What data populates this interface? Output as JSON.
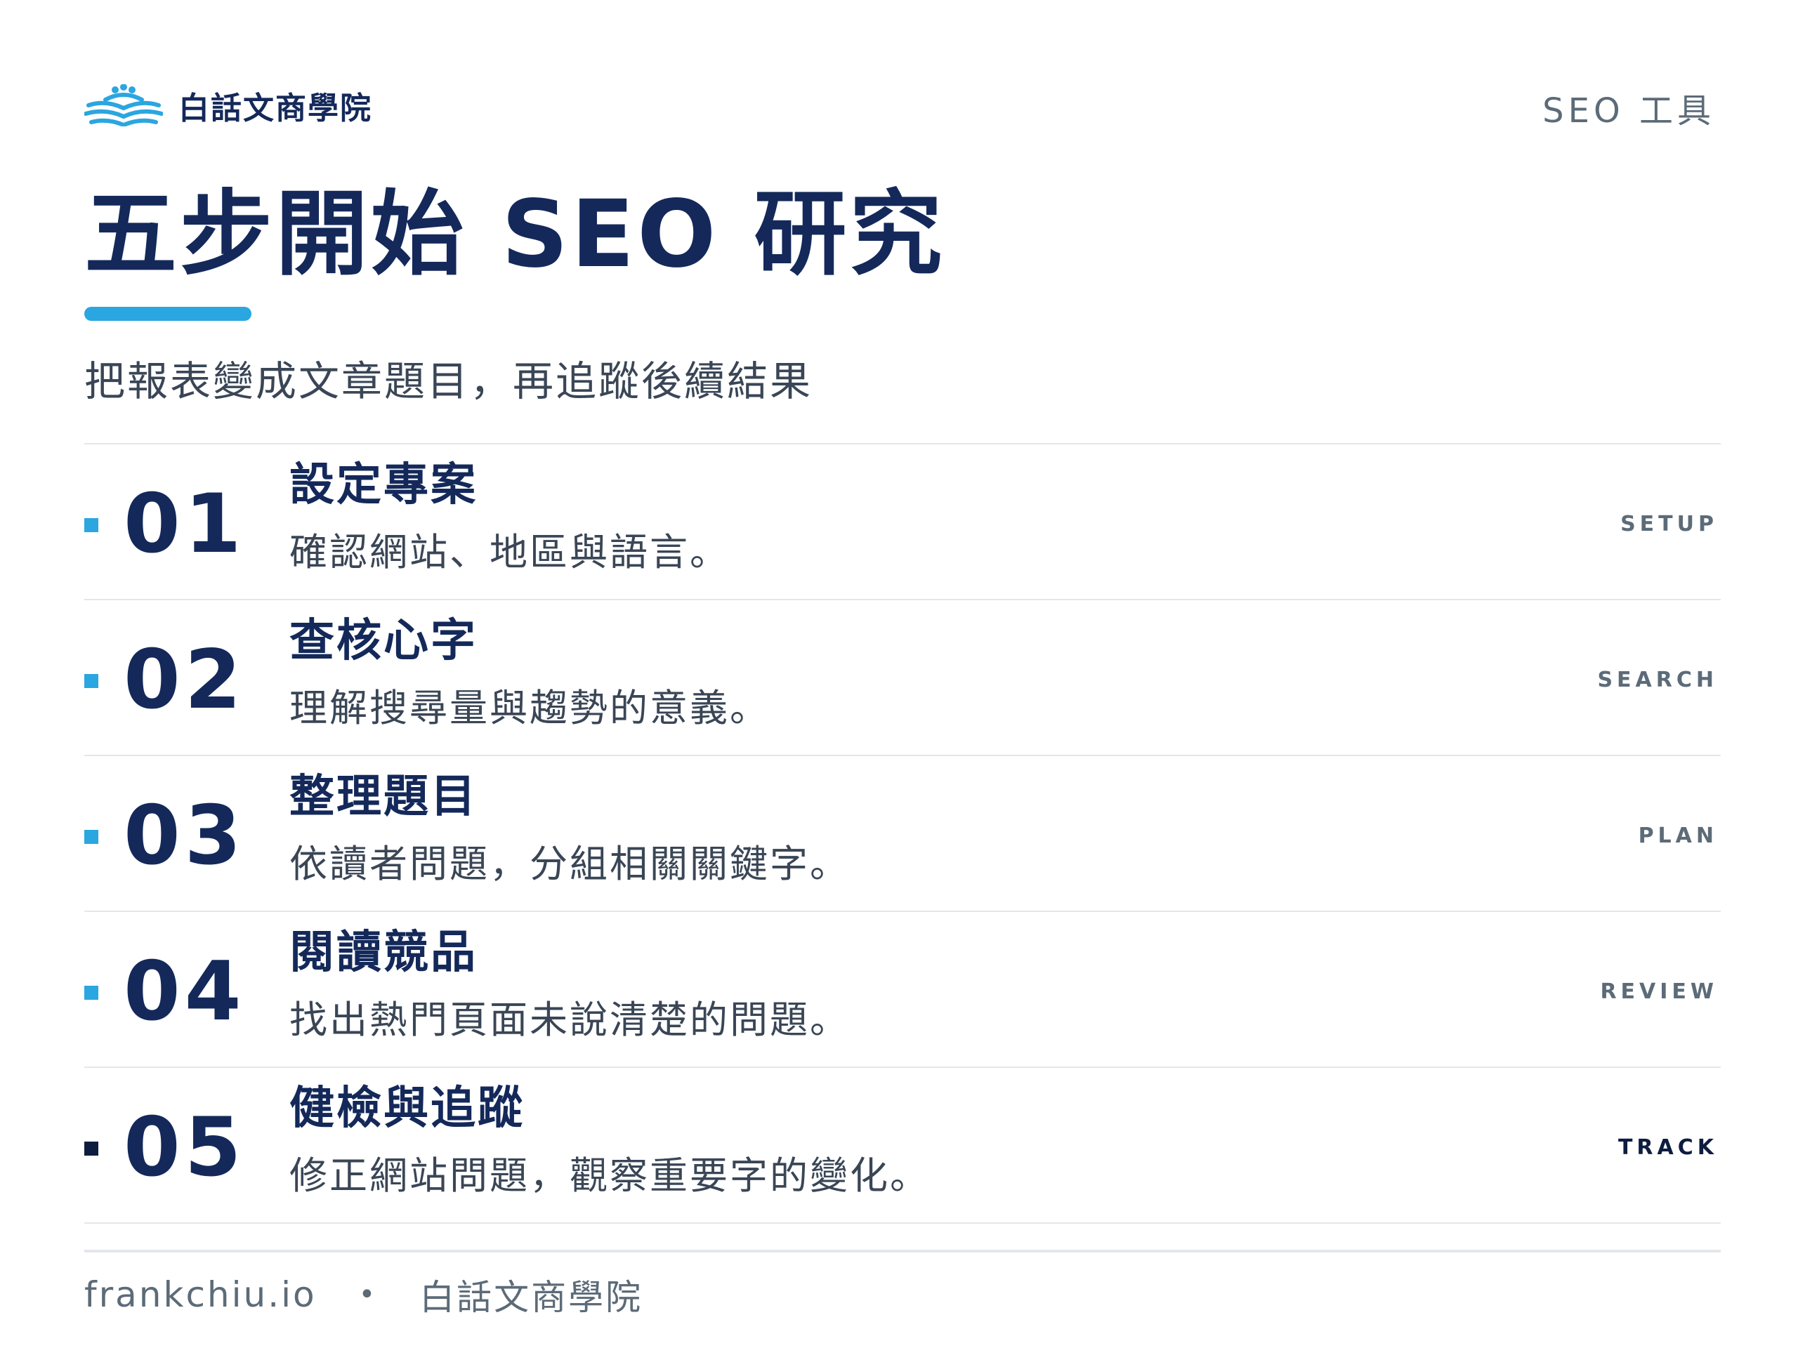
{
  "brand": {
    "name": "白話文商學院",
    "logo_icon": "open-book-people-icon",
    "accent_color": "#2aa6e0"
  },
  "header": {
    "tag": "SEO 工具"
  },
  "title": "五步開始 SEO 研究",
  "subtitle": "把報表變成文章題目，再追蹤後續結果",
  "colors": {
    "primary": "#14295a",
    "accent": "#2aa6e0",
    "muted": "#5c6b78"
  },
  "steps": [
    {
      "num": "01",
      "title": "設定專案",
      "desc": "確認網站、地區與語言。",
      "tag": "SETUP"
    },
    {
      "num": "02",
      "title": "查核心字",
      "desc": "理解搜尋量與趨勢的意義。",
      "tag": "SEARCH"
    },
    {
      "num": "03",
      "title": "整理題目",
      "desc": "依讀者問題，分組相關關鍵字。",
      "tag": "PLAN"
    },
    {
      "num": "04",
      "title": "閱讀競品",
      "desc": "找出熱門頁面未說清楚的問題。",
      "tag": "REVIEW"
    },
    {
      "num": "05",
      "title": "健檢與追蹤",
      "desc": "修正網站問題，觀察重要字的變化。",
      "tag": "TRACK"
    }
  ],
  "footer": {
    "site": "frankchiu.io",
    "separator": "•",
    "name": "白話文商學院"
  }
}
